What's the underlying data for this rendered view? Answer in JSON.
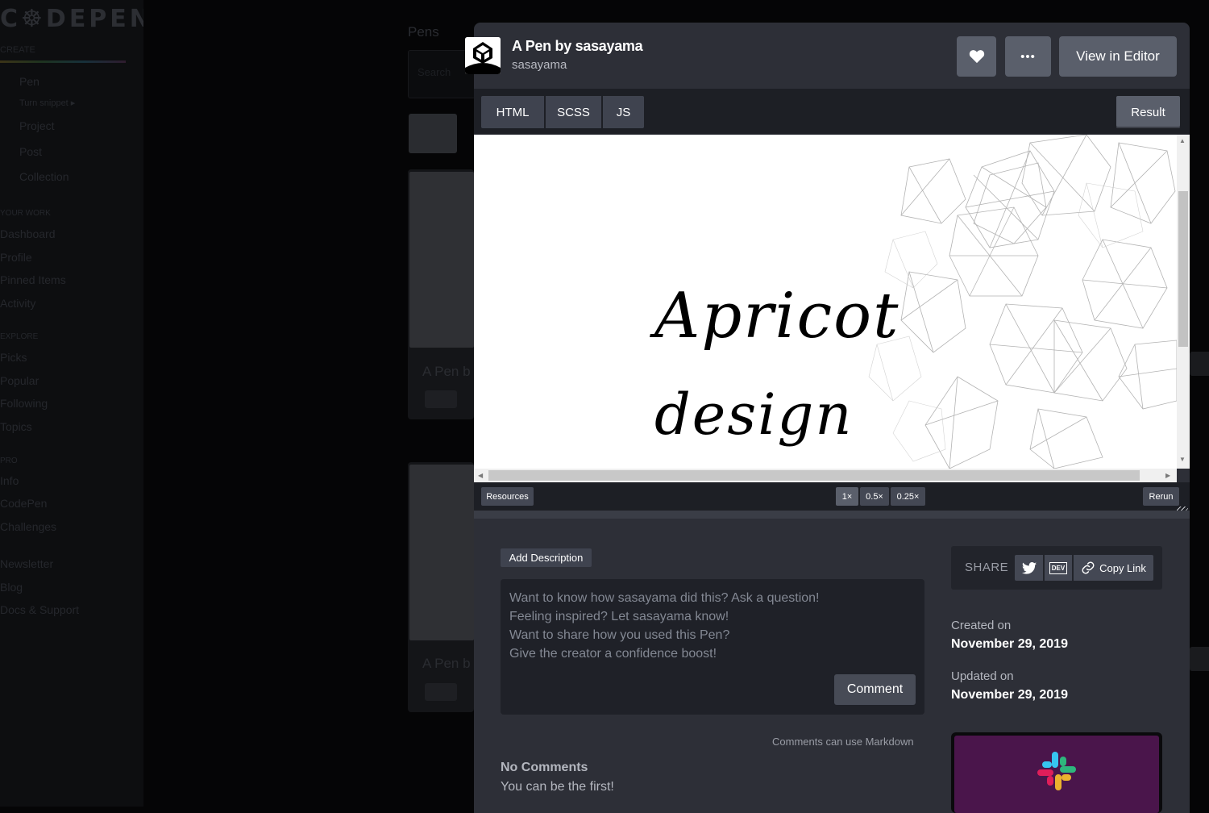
{
  "background": {
    "logo": "C☸DEPEN",
    "create_label": "CREATE",
    "nav": [
      "Pen",
      "Turn snippet ▸",
      "Project",
      "Post",
      "Collection"
    ],
    "sections": [
      {
        "title": "YOUR WORK",
        "items": [
          "Dashboard",
          "Profile",
          "Pinned Items",
          "Activity"
        ]
      },
      {
        "title": "EXPLORE",
        "items": [
          "Picks",
          "Popular",
          "Following",
          "Topics"
        ]
      },
      {
        "title": "PRO",
        "items": [
          "Info",
          "CodePen",
          "Challenges"
        ]
      }
    ],
    "footer": [
      "Newsletter",
      "Blog",
      "Docs & Support"
    ],
    "pens_title": "Pens",
    "search_placeholder": "Search",
    "card_title": "A Pen b"
  },
  "header": {
    "title": "A Pen by sasayama",
    "author": "sasayama",
    "view_in_editor": "View in Editor",
    "more_label": "•••"
  },
  "tabs": {
    "html": "HTML",
    "scss": "SCSS",
    "js": "JS",
    "result": "Result"
  },
  "preview": {
    "line1": "Apricot",
    "line2": "design"
  },
  "footer_bar": {
    "resources": "Resources",
    "zoom": [
      "1×",
      "0.5×",
      "0.25×"
    ],
    "rerun": "Rerun"
  },
  "details": {
    "add_description": "Add Description",
    "comment_prompts": [
      "Want to know how sasayama did this? Ask a question!",
      "Feeling inspired? Let sasayama know!",
      "Want to share how you used this Pen?",
      "Give the creator a confidence boost!"
    ],
    "comment_button": "Comment",
    "markdown_note": "Comments can use Markdown",
    "no_comments": "No Comments",
    "be_first": "You can be the first!"
  },
  "share": {
    "label": "SHARE",
    "copy_link": "Copy Link",
    "dev_label": "DEV"
  },
  "meta": {
    "created_label": "Created on",
    "created_date": "November 29, 2019",
    "updated_label": "Updated on",
    "updated_date": "November 29, 2019"
  },
  "colors": {
    "modal_bg": "#2d2f37",
    "button": "#5a5f6b",
    "tab": "#3f434f",
    "slack_purple": "#4a154b"
  }
}
